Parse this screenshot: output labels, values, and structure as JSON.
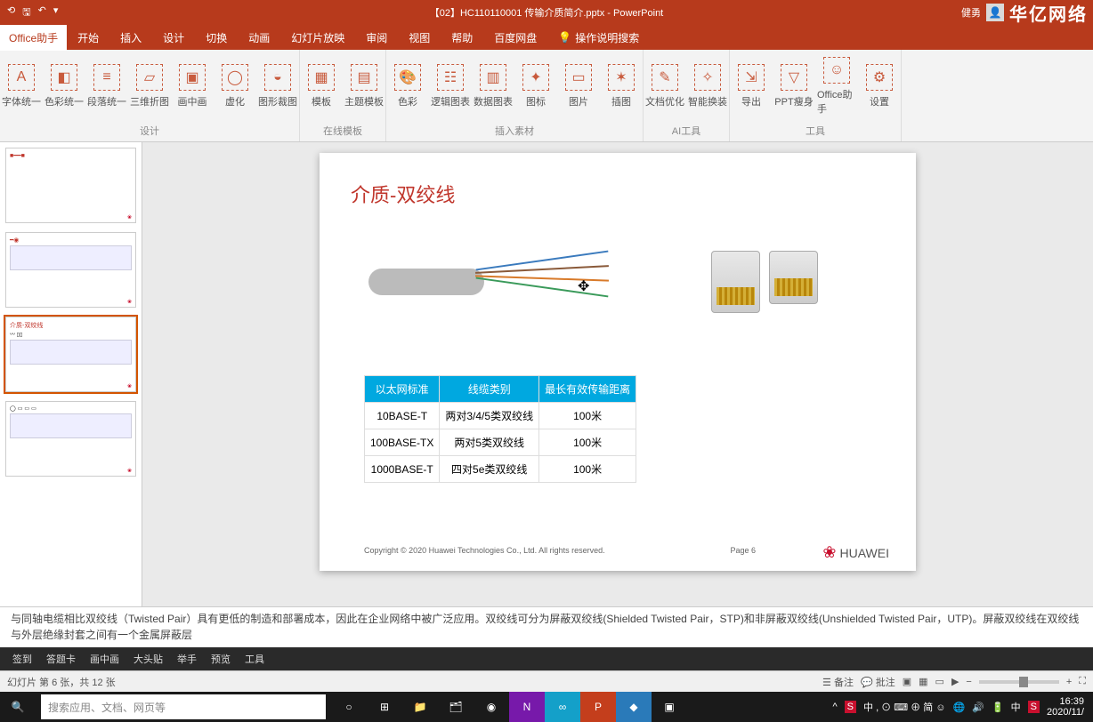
{
  "titlebar": {
    "title": "【02】HC110110001 传输介质简介.pptx - PowerPoint",
    "user": "健勇",
    "brand": "华亿网络"
  },
  "menu": {
    "active": "Office助手",
    "tabs": [
      "开始",
      "插入",
      "设计",
      "切换",
      "动画",
      "幻灯片放映",
      "审阅",
      "视图",
      "帮助",
      "百度网盘"
    ],
    "tell": "操作说明搜索"
  },
  "ribbon": {
    "g1": {
      "label": "设计",
      "btns": [
        "字体统一",
        "色彩统一",
        "段落统一",
        "三维折图",
        "画中画",
        "虚化",
        "图形裁图"
      ]
    },
    "g2": {
      "label": "在线模板",
      "btns": [
        "模板",
        "主题模板"
      ]
    },
    "g3": {
      "label": "插入素材",
      "btns": [
        "色彩",
        "逻辑图表",
        "数据图表",
        "图标",
        "图片",
        "插图"
      ]
    },
    "g4": {
      "label": "AI工具",
      "btns": [
        "文档优化",
        "智能换装"
      ]
    },
    "g5": {
      "label": "工具",
      "btns": [
        "导出",
        "PPT瘦身",
        "Office助手",
        "设置"
      ]
    }
  },
  "slide": {
    "title": "介质-双绞线",
    "table": {
      "headers": [
        "以太网标准",
        "线缆类别",
        "最长有效传输距离"
      ],
      "rows": [
        [
          "10BASE-T",
          "两对3/4/5类双绞线",
          "100米"
        ],
        [
          "100BASE-TX",
          "两对5类双绞线",
          "100米"
        ],
        [
          "1000BASE-T",
          "四对5e类双绞线",
          "100米"
        ]
      ]
    },
    "copyright": "Copyright © 2020 Huawei Technologies Co., Ltd. All rights reserved.",
    "page": "Page 6",
    "logo": "HUAWEI"
  },
  "notes": "与同轴电缆相比双绞线（Twisted Pair）具有更低的制造和部署成本，因此在企业网络中被广泛应用。双绞线可分为屏蔽双绞线(Shielded Twisted Pair，STP)和非屏蔽双绞线(Unshielded Twisted Pair，UTP)。屏蔽双绞线在双绞线与外层绝缘封套之间有一个金属屏蔽层",
  "toolbar2": [
    "签到",
    "答题卡",
    "画中画",
    "大头贴",
    "举手",
    "预览",
    "工具"
  ],
  "status": {
    "left": "幻灯片 第 6 张，共 12 张",
    "notes": "备注",
    "comments": "批注"
  },
  "taskbar": {
    "search": "搜索应用、文档、网页等",
    "ime": "中 , ⊙ ⌨ ⊕ 简 ☺",
    "time": "16:39",
    "date": "2020/11/"
  },
  "chart_data": {
    "type": "table",
    "title": "介质-双绞线",
    "columns": [
      "以太网标准",
      "线缆类别",
      "最长有效传输距离"
    ],
    "rows": [
      {
        "以太网标准": "10BASE-T",
        "线缆类别": "两对3/4/5类双绞线",
        "最长有效传输距离": "100米"
      },
      {
        "以太网标准": "100BASE-TX",
        "线缆类别": "两对5类双绞线",
        "最长有效传输距离": "100米"
      },
      {
        "以太网标准": "1000BASE-T",
        "线缆类别": "四对5e类双绞线",
        "最长有效传输距离": "100米"
      }
    ]
  }
}
